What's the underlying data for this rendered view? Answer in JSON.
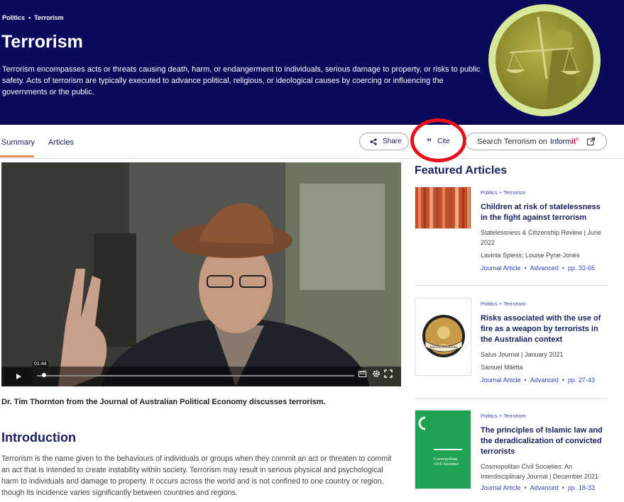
{
  "breadcrumb": [
    "Politics",
    "Terrorism"
  ],
  "page": {
    "title": "Terrorism",
    "description": "Terrorism encompasses acts or threats causing death, harm, or endangerment to individuals, serious damage to property, or risks to public safety. Acts of terrorism are typically executed to advance political, religious, or ideological causes by coercing or influencing the governments or the public."
  },
  "tabs": {
    "summary": "Summary",
    "articles": "Articles"
  },
  "actions": {
    "share": "Share",
    "cite": "Cite",
    "search_prefix": "Search Terrorism on",
    "search_brand_1": "Inform",
    "search_brand_2": "it"
  },
  "video": {
    "timecode": "01:44",
    "caption": "Dr. Tim Thornton from the Journal of Australian Political Economy discusses terrorism.",
    "cc": "CC"
  },
  "intro": {
    "title": "Introduction",
    "body": "Terrorism is the name given to the behaviours of individuals or groups when they commit an act or threaten to commit an act that is intended to create instability within society. Terrorism may result in serious physical and psychological harm to individuals and damage to property. It occurs across the world and is not confined to one country or region, though its incidence varies significantly between countries and regions."
  },
  "featured": {
    "title": "Featured Articles",
    "articles": [
      {
        "tags": [
          "Politics",
          "Terrorism"
        ],
        "title": "Children at risk of statelessness in the fight against terrorism",
        "source": "Statelessness & Citizenship Review | June 2022",
        "authors": "Lavinia Spiess; Louise Pyne-Jones",
        "type": "Journal Article",
        "level": "Advanced",
        "pages": "pp. 33-65"
      },
      {
        "tags": [
          "Politics",
          "Terrorism"
        ],
        "title": "Risks associated with the use of fire as a weapon by terrorists in the Australian context",
        "source": "Salus Journal | January 2021",
        "authors": "Samuel Miletta",
        "type": "Journal Article",
        "level": "Advanced",
        "pages": "pp. 27-43"
      },
      {
        "tags": [
          "Politics",
          "Terrorism"
        ],
        "title": "The principles of Islamic law and the deradicalization of convicted terrorists",
        "source": "Cosmopolitan Civil Societies: An Interdisciplinary Journal | December 2021",
        "authors": "",
        "type": "Journal Article",
        "level": "Advanced",
        "pages": "pp. 18-33"
      }
    ]
  },
  "colors": {
    "header_bg": "#0a0a5c",
    "accent": "#e68a5c",
    "link": "#3a44b8",
    "highlight": "#e80f1b"
  }
}
